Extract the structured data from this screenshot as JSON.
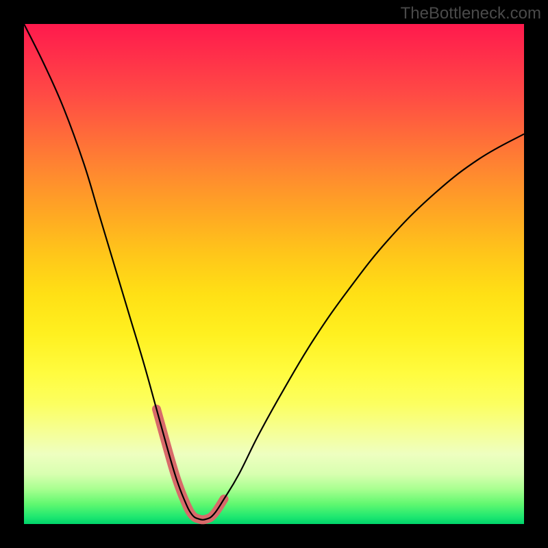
{
  "watermark": "TheBottleneck.com",
  "chart_data": {
    "type": "line",
    "title": "",
    "xlabel": "",
    "ylabel": "",
    "xlim": [
      0,
      100
    ],
    "ylim": [
      0,
      100
    ],
    "series": [
      {
        "name": "bottleneck-curve",
        "x": [
          0,
          4,
          8,
          12,
          15,
          18,
          21,
          24,
          26.5,
          29,
          30.5,
          32,
          33.5,
          35,
          36.5,
          38,
          40,
          43,
          47,
          52,
          58,
          65,
          73,
          82,
          91,
          100
        ],
        "y": [
          100,
          92,
          83,
          72,
          62,
          52,
          42,
          32,
          23,
          14,
          9,
          5,
          2,
          1,
          1,
          2,
          5,
          10,
          18,
          27,
          37,
          47,
          57,
          66,
          73,
          78
        ]
      }
    ],
    "highlight_region": {
      "description": "optimal-range-marker",
      "x_range": [
        26.5,
        40
      ],
      "y_range": [
        0,
        23
      ]
    },
    "gradient_stops": [
      {
        "pos": 0.0,
        "color": "#ff1a4d"
      },
      {
        "pos": 0.3,
        "color": "#ff8a2f"
      },
      {
        "pos": 0.55,
        "color": "#ffe015"
      },
      {
        "pos": 0.8,
        "color": "#f5ff9a"
      },
      {
        "pos": 0.95,
        "color": "#60f870"
      },
      {
        "pos": 1.0,
        "color": "#00d46b"
      }
    ]
  }
}
